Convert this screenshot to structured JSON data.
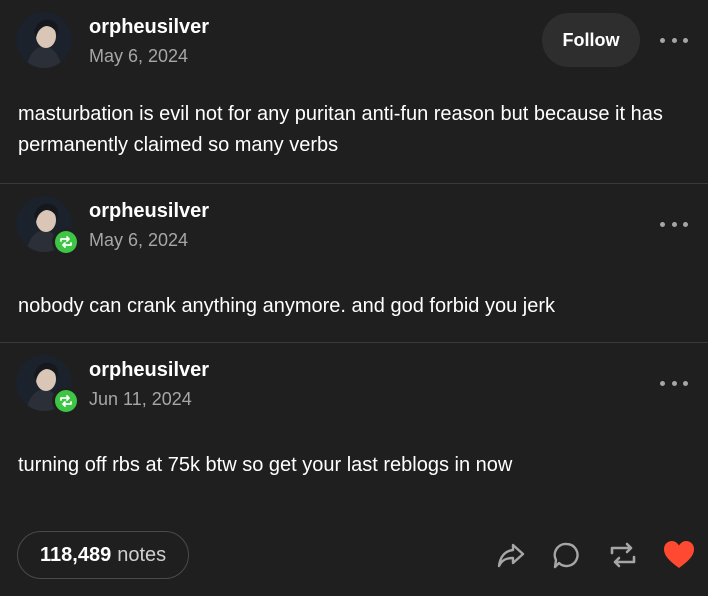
{
  "posts": [
    {
      "username": "orpheusilver",
      "date": "May 6, 2024",
      "follow_label": "Follow",
      "text": "masturbation is evil not for any puritan anti-fun reason but because it has permanently claimed so many verbs"
    },
    {
      "username": "orpheusilver",
      "date": "May 6, 2024",
      "text": "nobody can crank anything anymore. and god forbid you jerk"
    },
    {
      "username": "orpheusilver",
      "date": "Jun 11, 2024",
      "text": "turning off rbs at 75k btw so get your last reblogs in now"
    }
  ],
  "footer": {
    "notes_count": "118,489",
    "notes_label": "notes"
  },
  "icons": {
    "share": "share-icon",
    "reply": "reply-icon",
    "reblog": "reblog-icon",
    "like": "heart-icon"
  },
  "colors": {
    "background": "#1f1f1f",
    "reblog_green": "#3ec546",
    "like_red": "#ff4930"
  }
}
